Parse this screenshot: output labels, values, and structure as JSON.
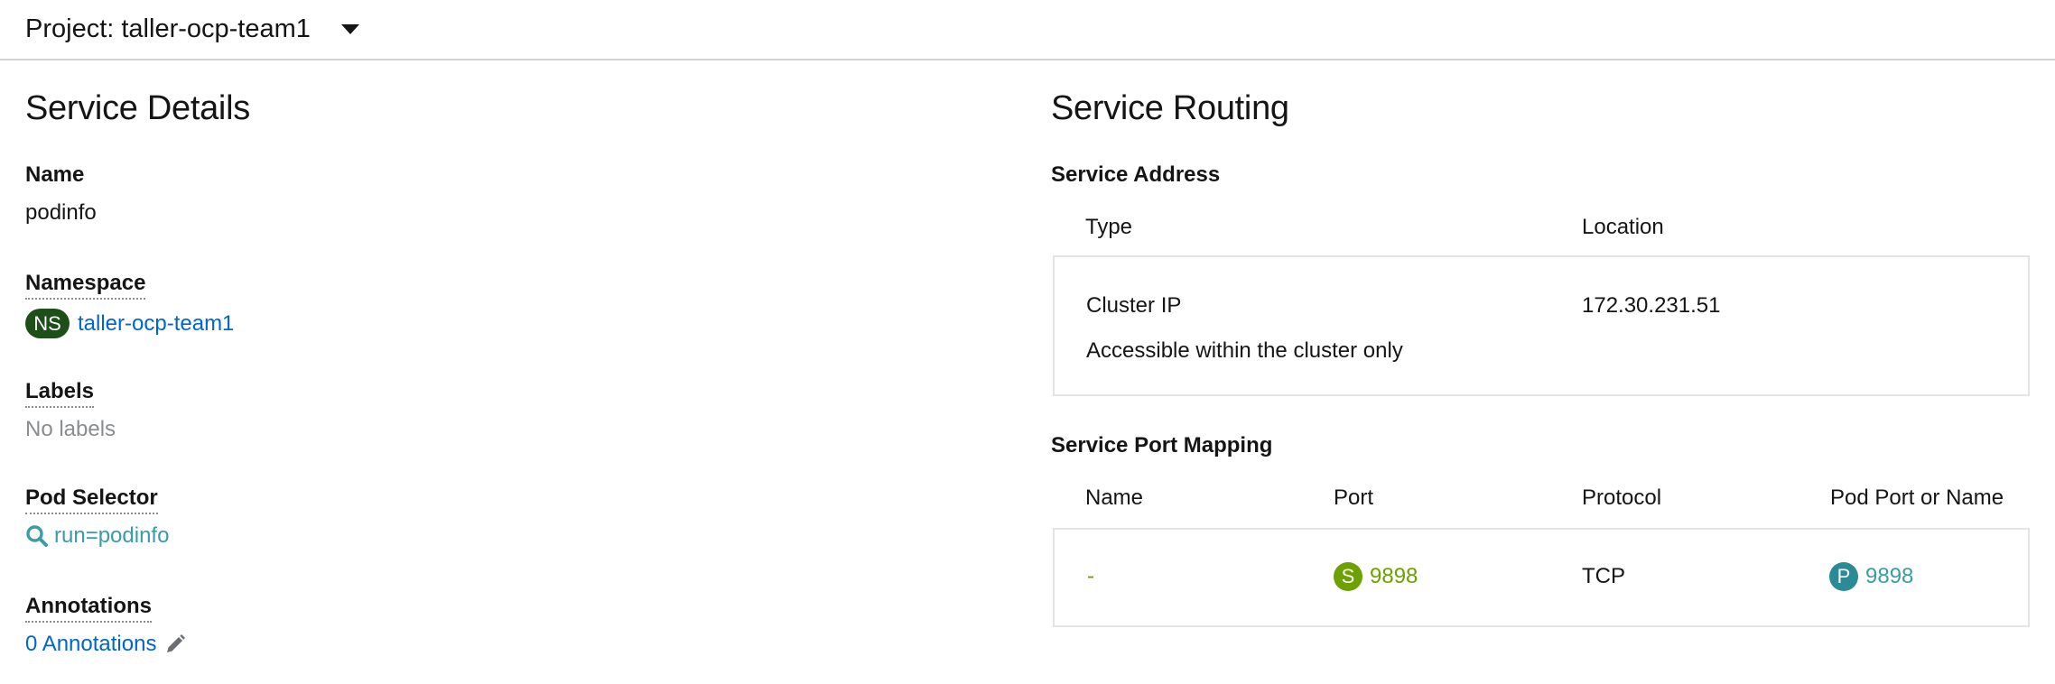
{
  "project_bar": {
    "label": "Project: taller-ocp-team1"
  },
  "service_details": {
    "title": "Service Details",
    "name": {
      "label": "Name",
      "value": "podinfo"
    },
    "namespace": {
      "label": "Namespace",
      "badge": "NS",
      "value": "taller-ocp-team1"
    },
    "labels": {
      "label": "Labels",
      "value": "No labels"
    },
    "pod_selector": {
      "label": "Pod Selector",
      "value": "run=podinfo"
    },
    "annotations": {
      "label": "Annotations",
      "value": "0 Annotations"
    }
  },
  "service_routing": {
    "title": "Service Routing",
    "address": {
      "heading": "Service Address",
      "columns": [
        "Type",
        "Location"
      ],
      "rows": [
        {
          "type": "Cluster IP",
          "description": "Accessible within the cluster only",
          "location": "172.30.231.51"
        }
      ]
    },
    "port_mapping": {
      "heading": "Service Port Mapping",
      "columns": [
        "Name",
        "Port",
        "Protocol",
        "Pod Port or Name"
      ],
      "rows": [
        {
          "name": "-",
          "port_badge": "S",
          "port": "9898",
          "protocol": "TCP",
          "pod_port_badge": "P",
          "pod_port": "9898"
        }
      ]
    }
  },
  "colors": {
    "namespace_badge": "#1e4f18",
    "service_badge": "#6ca100",
    "pod_badge": "#2a8b96",
    "link": "#0066cc"
  },
  "icons": [
    "caret-down-icon",
    "search-icon",
    "pencil-icon"
  ]
}
